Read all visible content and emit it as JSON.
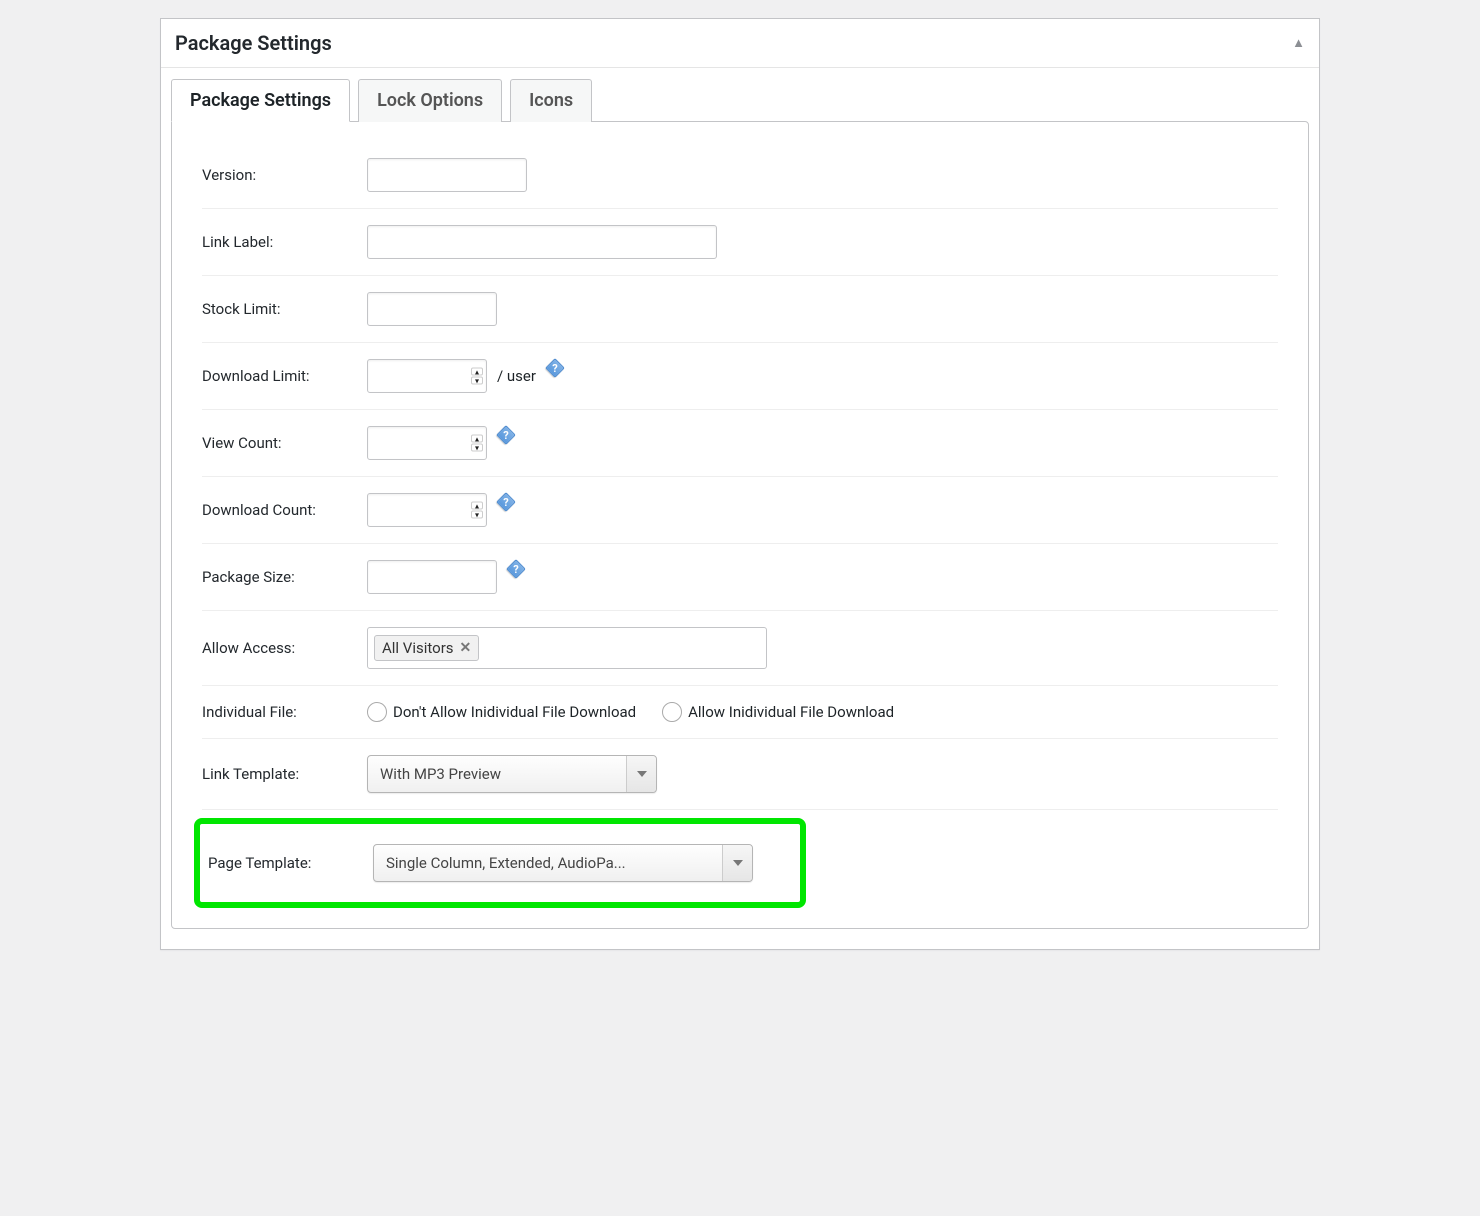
{
  "panel": {
    "title": "Package Settings"
  },
  "tabs": {
    "package": "Package Settings",
    "lock": "Lock Options",
    "icons": "Icons"
  },
  "fields": {
    "version": {
      "label": "Version:",
      "value": ""
    },
    "link_label": {
      "label": "Link Label:",
      "value": ""
    },
    "stock_limit": {
      "label": "Stock Limit:",
      "value": ""
    },
    "download_limit": {
      "label": "Download Limit:",
      "value": "",
      "suffix": "/ user"
    },
    "view_count": {
      "label": "View Count:",
      "value": ""
    },
    "download_count": {
      "label": "Download Count:",
      "value": ""
    },
    "package_size": {
      "label": "Package Size:",
      "value": ""
    },
    "allow_access": {
      "label": "Allow Access:",
      "token": "All Visitors"
    },
    "individual_file": {
      "label": "Individual File:",
      "dont_allow": "Don't Allow Inidividual File Download",
      "allow": "Allow Inidividual File Download"
    },
    "link_template": {
      "label": "Link Template:",
      "value": "With MP3 Preview"
    },
    "page_template": {
      "label": "Page Template:",
      "value": "Single Column, Extended, AudioPa..."
    }
  },
  "help_q": "?"
}
